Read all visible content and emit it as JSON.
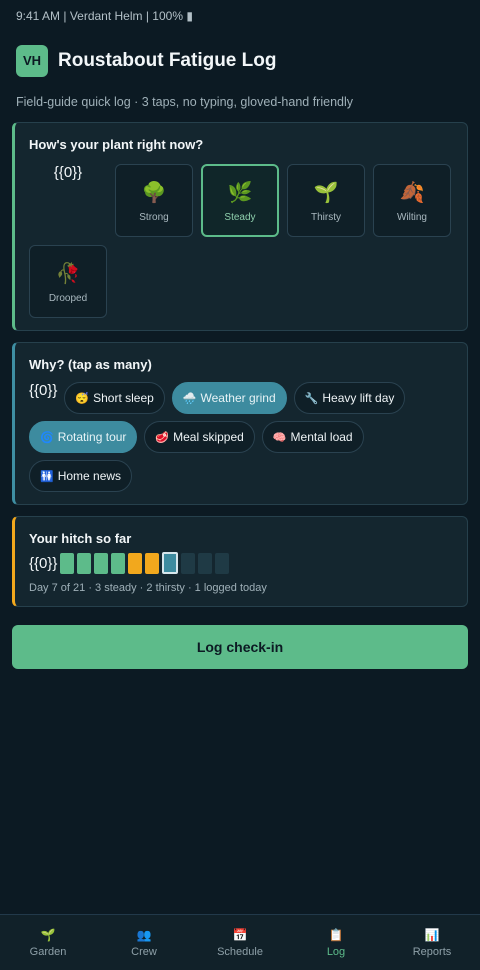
{
  "status_bar": {
    "text": "9:41 AM | Verdant Helm | 100% ▮"
  },
  "header": {
    "avatar": "VH",
    "title": "Roustabout Fatigue Log",
    "subtitle": "Field-guide quick log · 3 taps, no typing, gloved-hand friendly"
  },
  "plant_card": {
    "title": "How's your plant right now?",
    "placeholder": "{{0}}",
    "options": [
      {
        "emoji": "🌳",
        "label": "Strong"
      },
      {
        "emoji": "🌿",
        "label": "Steady"
      },
      {
        "emoji": "🌱",
        "label": "Thirsty"
      },
      {
        "emoji": "🍂",
        "label": "Wilting"
      },
      {
        "emoji": "🥀",
        "label": "Drooped"
      }
    ],
    "selected": "Steady"
  },
  "why_card": {
    "title": "Why? (tap as many)",
    "placeholder": "{{0}}",
    "chips": [
      {
        "emoji": "😴",
        "label": "Short sleep",
        "active": false
      },
      {
        "emoji": "🌧️",
        "label": "Weather grind",
        "active": true
      },
      {
        "emoji": "🔧",
        "label": "Heavy lift day",
        "active": false
      },
      {
        "emoji": "🌀",
        "label": "Rotating tour",
        "active": true
      },
      {
        "emoji": "🥩",
        "label": "Meal skipped",
        "active": false
      },
      {
        "emoji": "🧠",
        "label": "Mental load",
        "active": false
      },
      {
        "emoji": "🚻",
        "label": "Home news",
        "active": false
      }
    ]
  },
  "hitch_card": {
    "title": "Your hitch so far",
    "placeholder": "{{0}}",
    "days": [
      "steady",
      "steady",
      "steady",
      "steady",
      "thirsty",
      "thirsty",
      "today",
      "empty",
      "empty",
      "empty"
    ],
    "note": "Day 7 of 21 · 3 steady · 2 thirsty · 1 logged today"
  },
  "log_button": {
    "label": "Log check-in"
  },
  "tabs": [
    {
      "icon": "🌱",
      "label": "Garden",
      "active": false
    },
    {
      "icon": "👥",
      "label": "Crew",
      "active": false
    },
    {
      "icon": "📅",
      "label": "Schedule",
      "active": false
    },
    {
      "icon": "📋",
      "label": "Log",
      "active": true
    },
    {
      "icon": "📊",
      "label": "Reports",
      "active": false
    }
  ],
  "colors": {
    "background": "#0c1a23",
    "accent_green": "#5dbb8a",
    "accent_teal": "#3d8b9f",
    "accent_amber": "#f2a81d"
  }
}
